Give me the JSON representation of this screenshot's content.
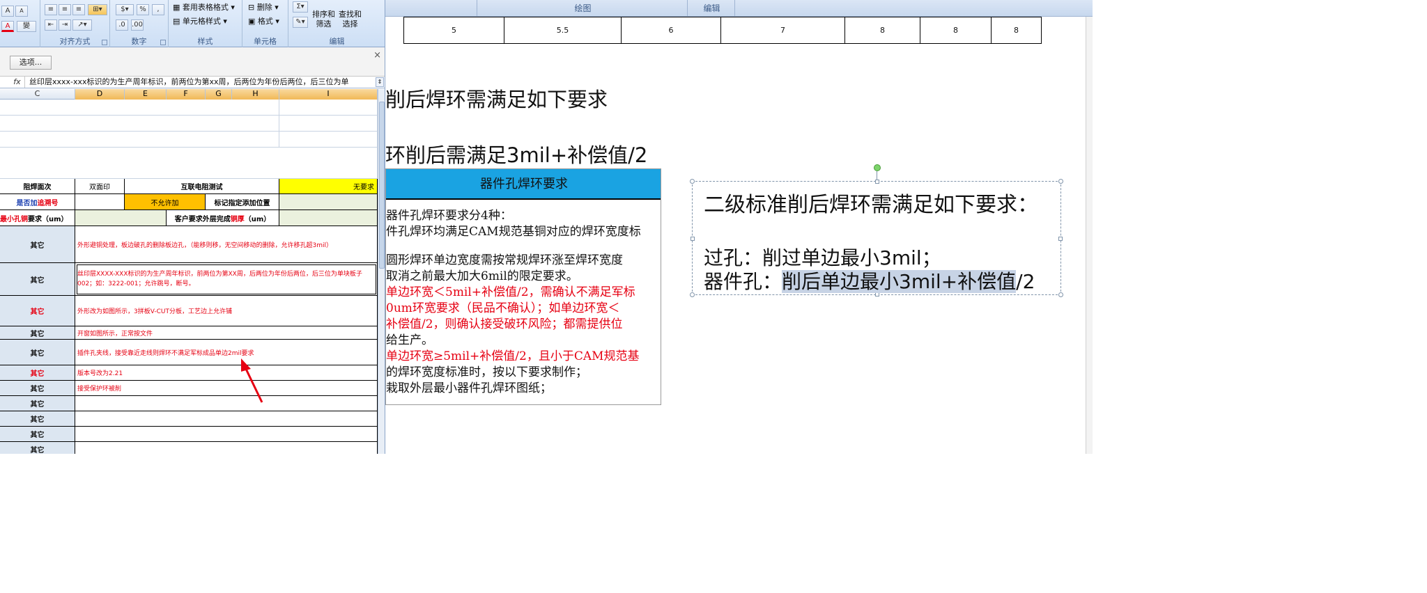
{
  "excel": {
    "ribbon": {
      "groups": [
        {
          "label": "对齐方式"
        },
        {
          "label": "数字"
        },
        {
          "label": "样式"
        },
        {
          "label": "单元格"
        },
        {
          "label": "编辑"
        }
      ],
      "font_glyphs": {
        "grow": "A",
        "shrink": "A",
        "color": "A",
        "phonetic": "變"
      },
      "number_format_percent": "%",
      "number_format_comma": ",",
      "style_table_format": "套用表格格式",
      "style_cell_style": "单元格样式",
      "cell_delete": "删除",
      "cell_format": "格式",
      "edit_sort_filter": [
        "排序和",
        "筛选"
      ],
      "edit_find_select": [
        "查找和",
        "选择"
      ]
    },
    "message_bar": {
      "options_button": "选项...",
      "close": "×"
    },
    "formula_bar": {
      "fx": "fx",
      "content": "丝印层xxxx-xxx标识的为生产周年标识，前两位为第xx周，后两位为年份后两位，后三位为单"
    },
    "columns": [
      "C",
      "D",
      "E",
      "F",
      "G",
      "H",
      "I"
    ],
    "rows": {
      "r1": {
        "c": "阻焊面次",
        "d": "双面印",
        "ef": "互联电阻测试",
        "i": "无要求"
      },
      "r2": {
        "c_a": "是否加",
        "c_b": "追溯号",
        "ef": "不允许加",
        "gh": "标记指定添加位置"
      },
      "r3": {
        "c_a": "最小孔铜",
        "c_b": "要求（um）",
        "gh_a": "客户要求外层完成",
        "gh_b": "铜厚",
        "gh_c": "（um）"
      },
      "notes": [
        {
          "label": "其它",
          "text": "外形避铜处理，板边破孔的删除板边孔，（能移则移，无空间移动的删除，允许移孔超3mil）",
          "label_red": false
        },
        {
          "label": "其它",
          "text": "丝印层XXXX-XXX标识的为生产周年标识，前两位为第XX周，后两位为年份后两位，后三位为单块板子002；如：3222-001；允许跳号，断号。",
          "label_red": false
        },
        {
          "label": "其它",
          "text": "外形改为如图所示，3拼板V-CUT分板，工艺边上允许铺",
          "label_red": true
        },
        {
          "label": "其它",
          "text": "开窗如图所示，正常按文件",
          "label_red": false
        },
        {
          "label": "其它",
          "text": "插件孔夹线，接受靠近走线则焊环不满足军标成品单边2mil要求",
          "label_red": false
        },
        {
          "label": "其它",
          "text": "版本号改为2.21",
          "label_red": true
        },
        {
          "label": "其它",
          "text": "接受保护环被削",
          "label_red": false
        },
        {
          "label": "其它",
          "text": "",
          "label_red": false
        },
        {
          "label": "其它",
          "text": "",
          "label_red": false
        },
        {
          "label": "其它",
          "text": "",
          "label_red": false
        },
        {
          "label": "其它",
          "text": "",
          "label_red": false
        }
      ]
    }
  },
  "word": {
    "top_groups": [
      "绘图",
      "编辑"
    ],
    "table_row": [
      "5",
      "5.5",
      "6",
      "7",
      "8",
      "8",
      "8"
    ],
    "heading1": "削后焊环需满足如下要求",
    "heading2": "环削后需满足3mil+补偿值/2",
    "image": {
      "title": "器件孔焊环要求",
      "lines": [
        {
          "text": "器件孔焊环要求分4种：",
          "color": "#111111"
        },
        {
          "text": "件孔焊环均满足CAM规范基铜对应的焊环宽度标",
          "color": "#111111"
        },
        {
          "text": "",
          "color": "#111111"
        },
        {
          "text": "圆形焊环单边宽度需按常规焊环涨至焊环宽度",
          "color": "#111111"
        },
        {
          "text": "取消之前最大加大6mil的限定要求。",
          "color": "#111111"
        },
        {
          "text": "单边环宽＜5mil+补偿值/2，需确认不满足军标",
          "color": "#e60012"
        },
        {
          "text": "0um环宽要求（民品不确认）；如单边环宽＜",
          "color": "#e60012"
        },
        {
          "text": "补偿值/2，则确认接受破环风险；都需提供位",
          "color": "#e60012"
        },
        {
          "text": "给生产。",
          "color": "#111111"
        },
        {
          "text": "单边环宽≥5mil+补偿值/2，且小于CAM规范基",
          "color": "#e60012"
        },
        {
          "text": "的焊环宽度标准时，按以下要求制作；",
          "color": "#111111"
        },
        {
          "text": "栽取外层最小器件孔焊环图纸；",
          "color": "#111111"
        }
      ]
    },
    "textbox": {
      "line1": "二级标准削后焊环需满足如下要求：",
      "line2": "过孔：削过单边最小3mil；",
      "line3_prefix": "器件孔：",
      "line3_highlight": "削后单边最小3mil+补偿值",
      "line3_suffix": "/2"
    }
  },
  "colors": {
    "accent_blue": "#1aa3e2",
    "highlight_yellow": "#ffff00",
    "warn_orange": "#ffc000",
    "red_text": "#e60012"
  }
}
